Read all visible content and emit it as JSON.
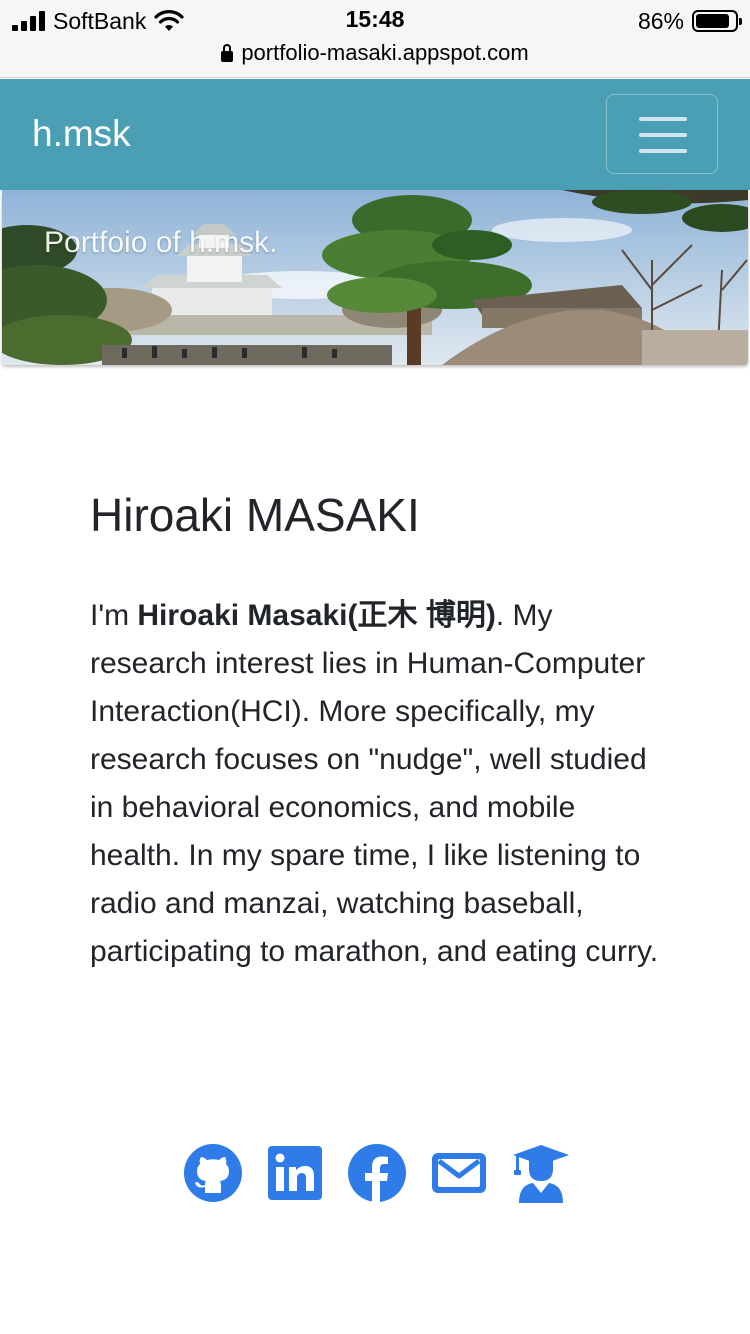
{
  "status_bar": {
    "carrier": "SoftBank",
    "time": "15:48",
    "battery_percent": "86%",
    "battery_level": 0.86,
    "url": "portfolio-masaki.appspot.com"
  },
  "navbar": {
    "brand": "h.msk",
    "toggler_icon": "hamburger-menu-icon",
    "background_color": "#4a9fb5"
  },
  "hero": {
    "caption": "Portfoio of h.msk."
  },
  "profile": {
    "name": "Hiroaki MASAKI",
    "bio_intro": "I'm ",
    "bio_name": "Hiroaki Masaki(正木 博明)",
    "bio_rest": ". My research interest lies in Human-Computer Interaction(HCI). More specifically, my research focuses on \"nudge\", well studied in behavioral economics, and mobile health. In my spare time, I like listening to radio and manzai, watching baseball, participating to marathon, and eating curry."
  },
  "social_links": [
    {
      "icon": "github-icon"
    },
    {
      "icon": "linkedin-icon"
    },
    {
      "icon": "facebook-icon"
    },
    {
      "icon": "mail-icon"
    },
    {
      "icon": "graduate-scholar-icon"
    }
  ],
  "colors": {
    "accent": "#2f7be8",
    "text": "#212529"
  }
}
